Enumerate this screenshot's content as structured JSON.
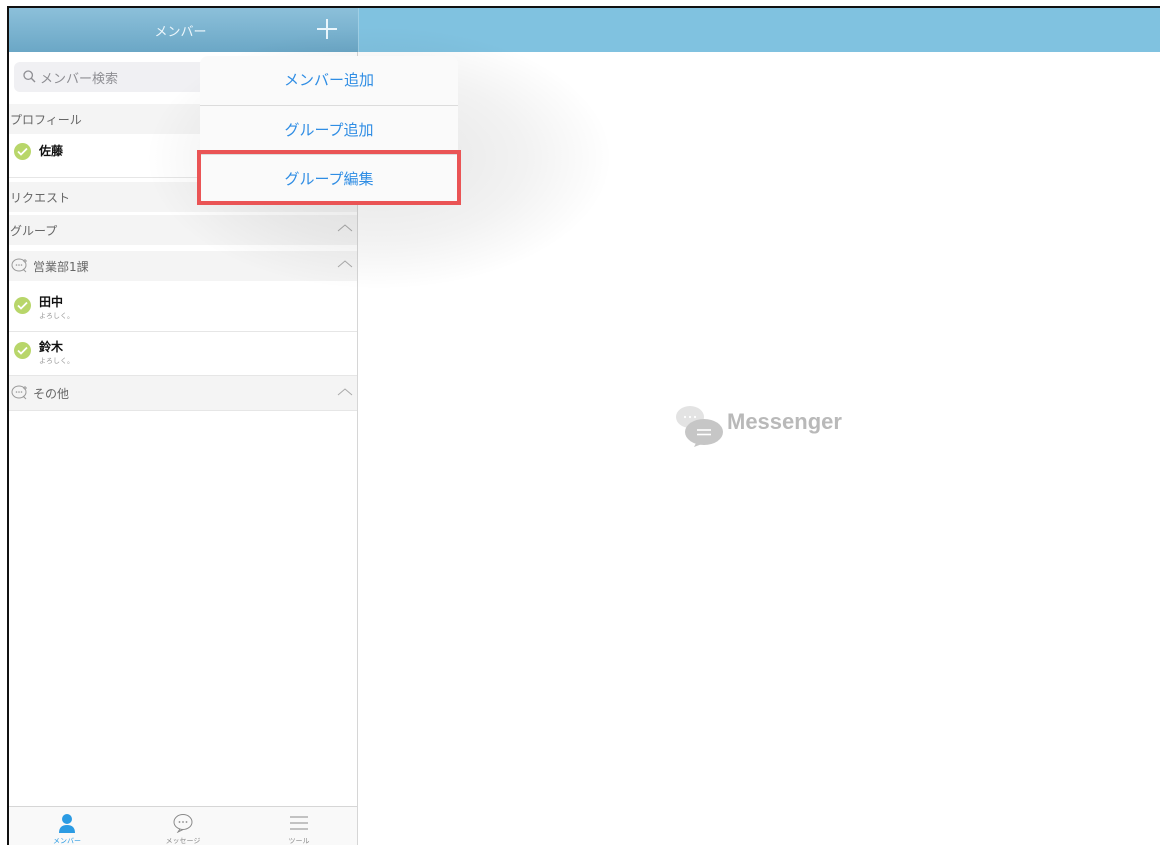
{
  "header": {
    "title": "メンバー",
    "add_icon": "plus-icon"
  },
  "search": {
    "placeholder": "メンバー検索"
  },
  "sections": {
    "profile": "プロフィール",
    "request": "リクエスト",
    "groups": "グループ"
  },
  "profile_user": {
    "name": "佐藤"
  },
  "groups": [
    {
      "name": "営業部1課",
      "members": [
        {
          "name": "田中",
          "status": "よろしく。"
        },
        {
          "name": "鈴木",
          "status": "よろしく。"
        }
      ]
    },
    {
      "name": "その他",
      "members": []
    }
  ],
  "popover": {
    "items": [
      "メンバー追加",
      "グループ追加",
      "グループ編集"
    ],
    "highlighted": "グループ編集",
    "highlight_color": "#ea5455"
  },
  "main": {
    "logo_text": "Messenger"
  },
  "tabbar": {
    "tabs": [
      {
        "label": "メンバー",
        "icon": "person-icon",
        "active": true
      },
      {
        "label": "メッセージ",
        "icon": "chat-bubble-icon",
        "active": false
      },
      {
        "label": "ツール",
        "icon": "menu-icon",
        "active": false
      }
    ]
  },
  "colors": {
    "topbar": "#80c2e0",
    "accent": "#2f8de4",
    "online": "#b8d66a"
  }
}
